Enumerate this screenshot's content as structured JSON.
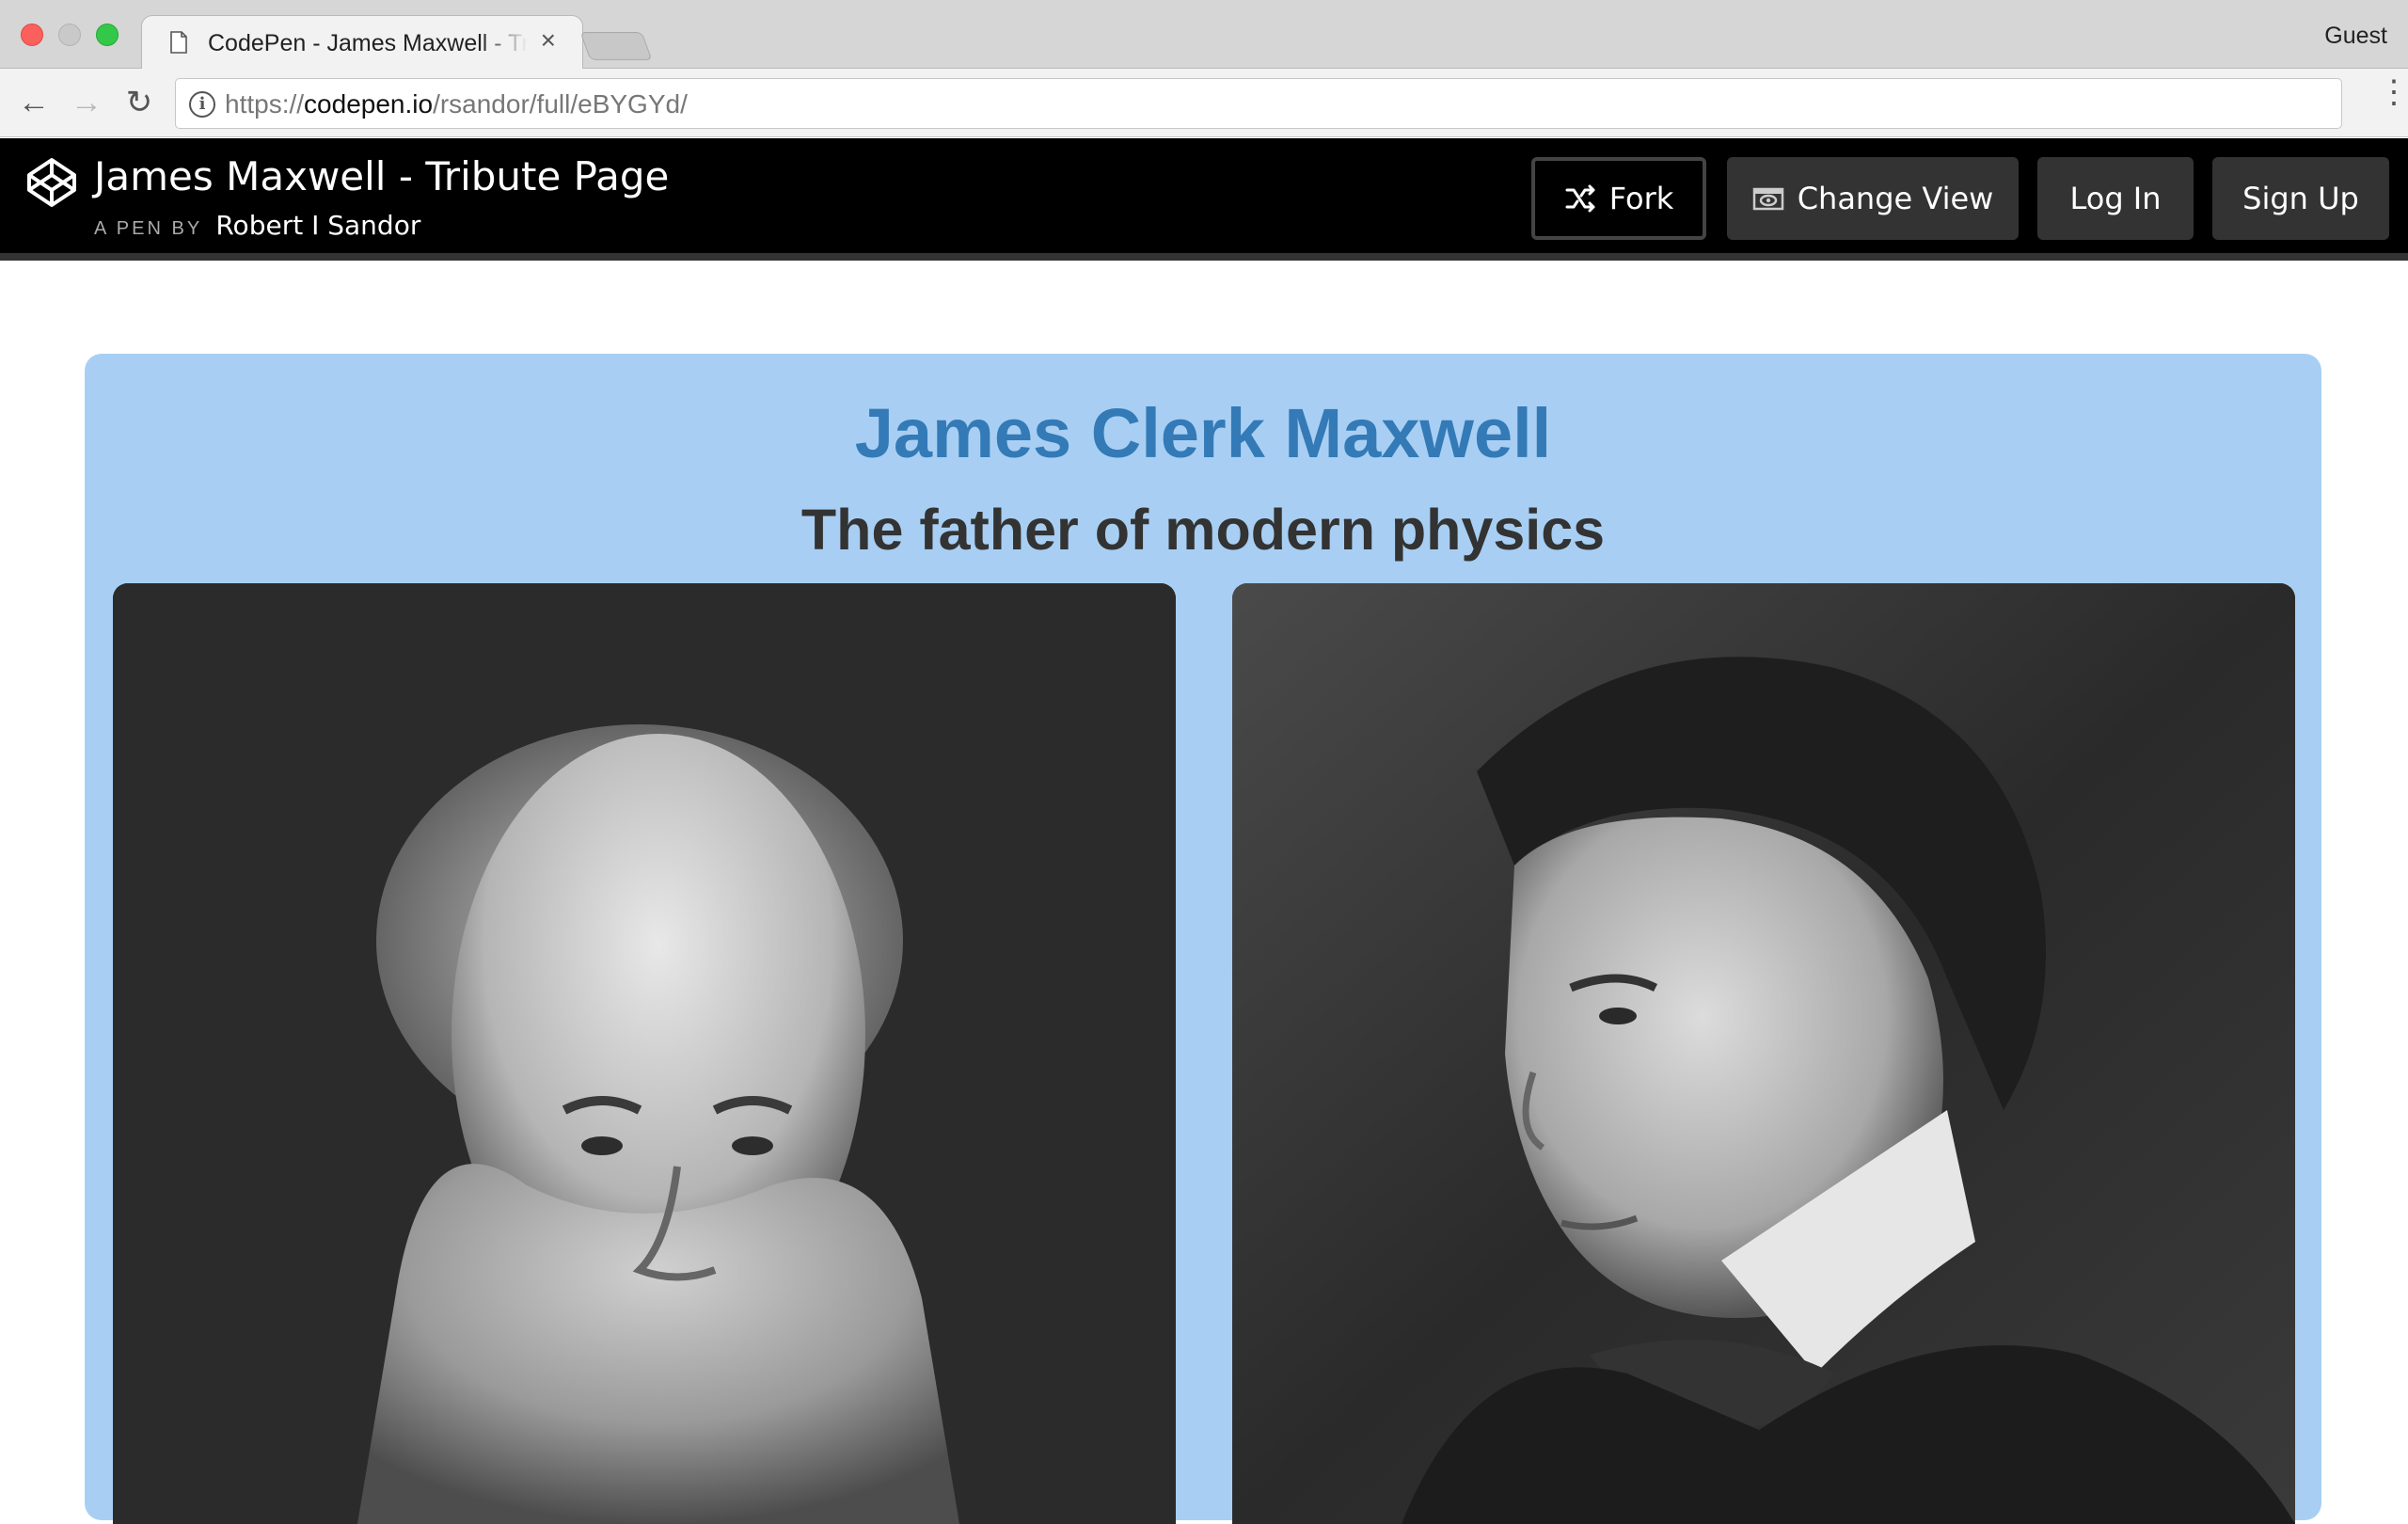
{
  "browser": {
    "tab_title": "CodePen - James Maxwell - Tribute Page",
    "tab_close": "×",
    "profile": "Guest",
    "url_prefix": "https://",
    "url_host": "codepen.io",
    "url_path": "/rsandor/full/eBYGYd/",
    "info_icon": "i",
    "back_icon": "←",
    "forward_icon": "→",
    "reload_icon": "↻",
    "menu_icon": "⋮"
  },
  "codepen": {
    "pen_title": "James Maxwell - Tribute Page",
    "byline": "A PEN BY",
    "author": "Robert I Sandor",
    "buttons": {
      "fork": "Fork",
      "change_view": "Change View",
      "log_in": "Log In",
      "sign_up": "Sign Up"
    }
  },
  "page": {
    "title": "James Clerk Maxwell",
    "subtitle": "The father of modern physics"
  },
  "colors": {
    "content_bg": "#a8cff3",
    "title_color": "#337ab7",
    "header_bg": "#000000",
    "button_bg": "#333333"
  },
  "icons": {
    "logo": "codepen-logo-icon",
    "fork": "fork-icon",
    "change_view": "eye-icon",
    "tab_page": "page-icon"
  }
}
